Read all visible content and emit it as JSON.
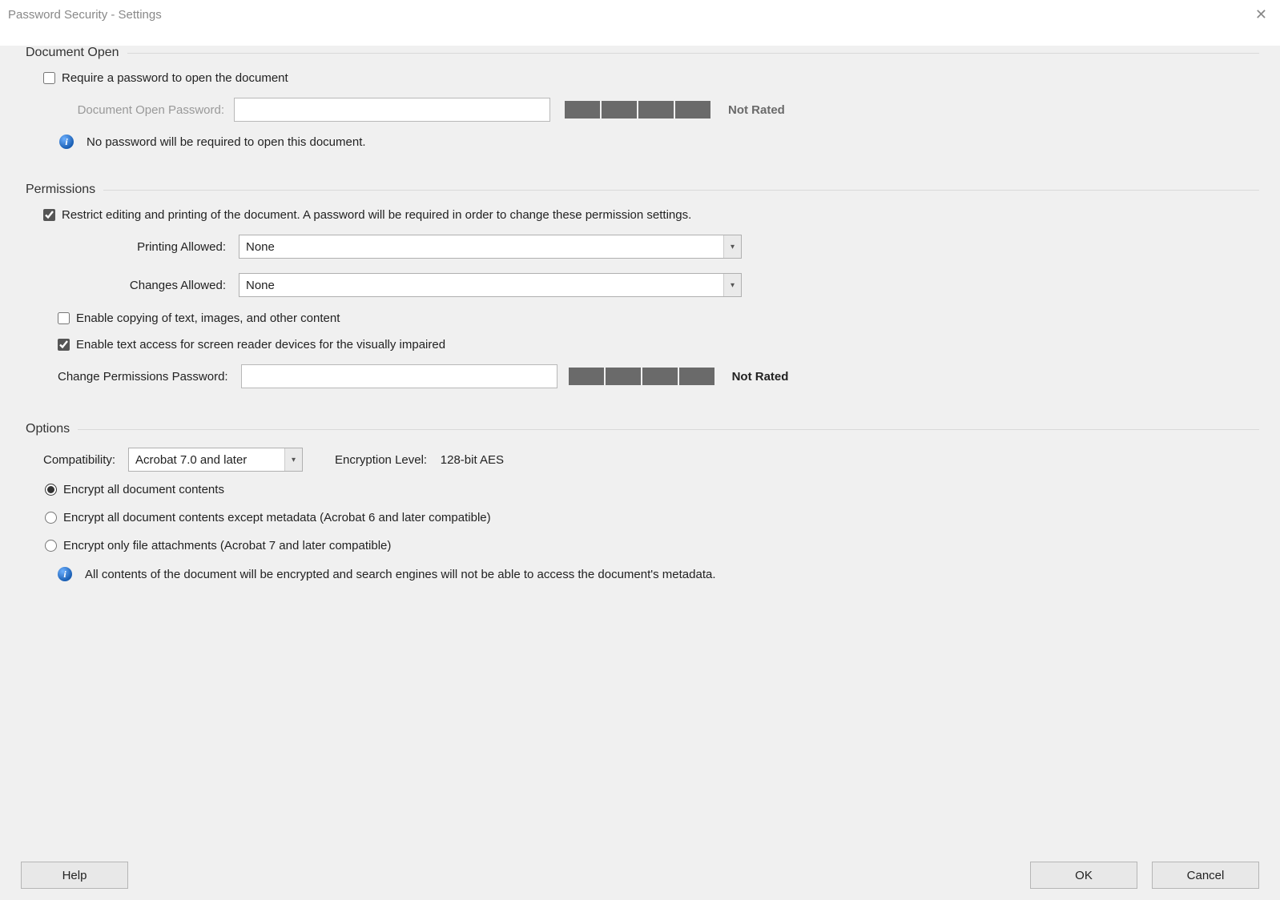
{
  "window": {
    "title": "Password Security - Settings"
  },
  "docOpen": {
    "legend": "Document Open",
    "require_pw_label": "Require a password to open the document",
    "require_pw_checked": false,
    "pw_label": "Document Open Password:",
    "pw_value": "",
    "strength_text": "Not Rated",
    "info_text": "No password will be required to open this document."
  },
  "permissions": {
    "legend": "Permissions",
    "restrict_label": "Restrict editing and printing of the document. A password will be required in order to change these permission settings.",
    "restrict_checked": true,
    "printing_label": "Printing Allowed:",
    "printing_value": "None",
    "changes_label": "Changes Allowed:",
    "changes_value": "None",
    "enable_copy_label": "Enable copying of text, images, and other content",
    "enable_copy_checked": false,
    "enable_access_label": "Enable text access for screen reader devices for the visually impaired",
    "enable_access_checked": true,
    "change_pw_label": "Change Permissions Password:",
    "change_pw_value": "",
    "strength_text": "Not Rated"
  },
  "options": {
    "legend": "Options",
    "compat_label": "Compatibility:",
    "compat_value": "Acrobat 7.0 and later",
    "enc_label": "Encryption  Level:",
    "enc_value": "128-bit AES",
    "radio_selected": "all",
    "radio_all": "Encrypt all document contents",
    "radio_except": "Encrypt all document contents except metadata (Acrobat 6 and later compatible)",
    "radio_attach": "Encrypt only file attachments (Acrobat 7 and later compatible)",
    "info_text": "All contents of the document will be encrypted and search engines will not be able to access the document's metadata."
  },
  "footer": {
    "help": "Help",
    "ok": "OK",
    "cancel": "Cancel"
  }
}
